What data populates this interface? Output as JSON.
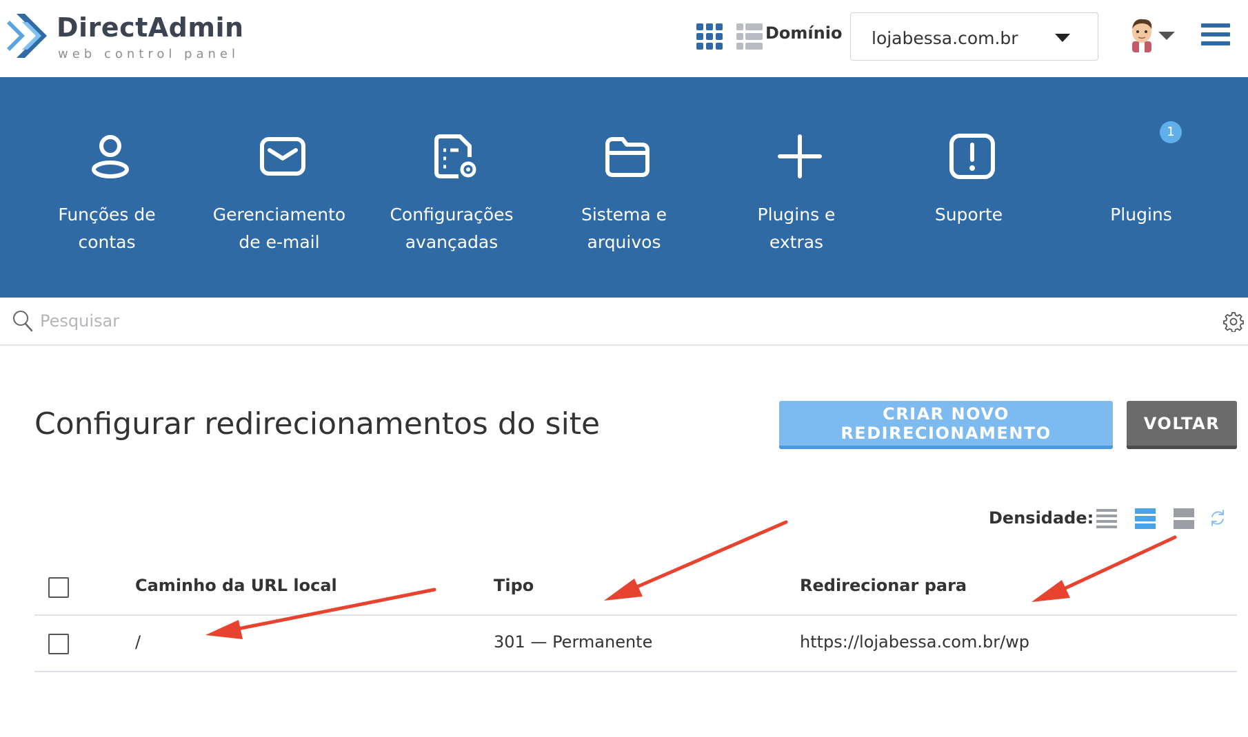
{
  "header": {
    "logo_title": "DirectAdmin",
    "logo_subtitle": "web control panel",
    "domain_label": "Domínio",
    "domain_selected": "lojabessa.com.br",
    "accent_color": "#306aa5"
  },
  "nav": {
    "items": [
      {
        "label": "Funções de",
        "label2": "contas",
        "icon": "user-icon"
      },
      {
        "label": "Gerenciamento",
        "label2": "de e-mail",
        "icon": "mail-icon"
      },
      {
        "label": "Configurações",
        "label2": "avançadas",
        "icon": "document-gear-icon"
      },
      {
        "label": "Sistema e",
        "label2": "arquivos",
        "icon": "folder-icon"
      },
      {
        "label": "Plugins e",
        "label2": "extras",
        "icon": "plus-icon"
      },
      {
        "label": "Suporte",
        "label2": "",
        "icon": "alert-icon"
      },
      {
        "label": "Plugins",
        "label2": "",
        "icon": ""
      }
    ],
    "plugins_badge": "1"
  },
  "search": {
    "placeholder": "Pesquisar"
  },
  "page": {
    "title": "Configurar redirecionamentos do site",
    "create_button": "CRIAR NOVO REDIRECIONAMENTO",
    "back_button": "VOLTAR",
    "density_label": "Densidade:"
  },
  "table": {
    "headers": [
      "Caminho da URL local",
      "Tipo",
      "Redirecionar para"
    ],
    "rows": [
      [
        "/",
        "301 — Permanente",
        "https://lojabessa.com.br/wp"
      ]
    ]
  }
}
